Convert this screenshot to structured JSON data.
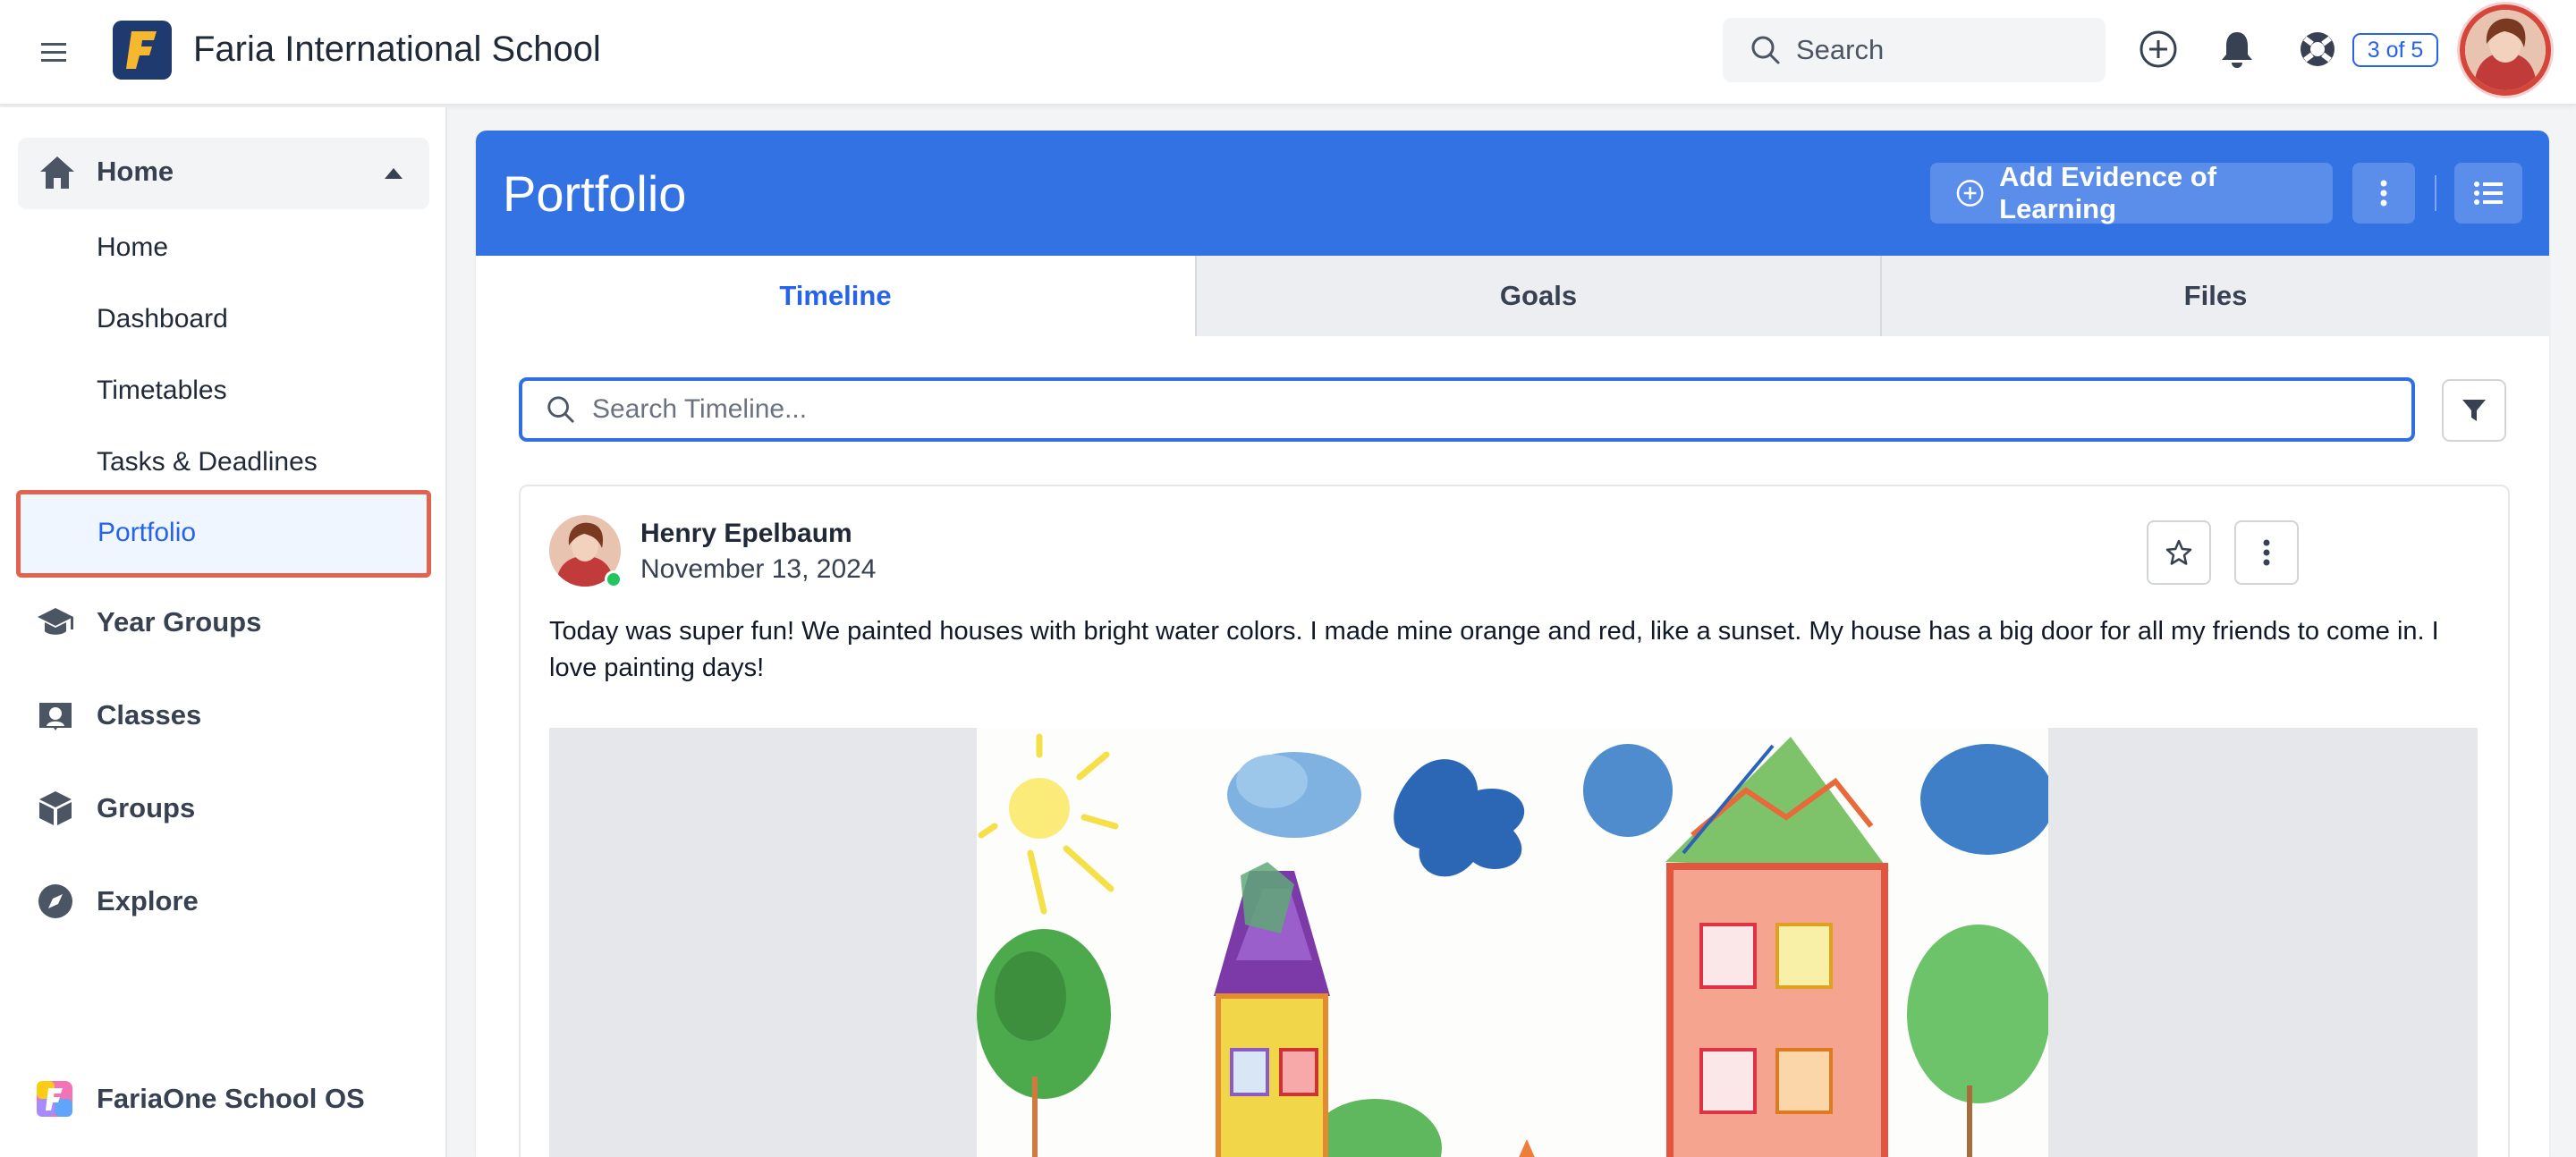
{
  "topbar": {
    "school_name": "Faria International School",
    "search_placeholder": "Search",
    "help_badge": "3 of 5",
    "icons": [
      "menu-icon",
      "faria-logo",
      "search-icon",
      "add-circle-icon",
      "bell-icon",
      "lifebuoy-icon"
    ]
  },
  "sidebar": {
    "section": {
      "label": "Home",
      "icon": "home-icon"
    },
    "sub_items": [
      "Home",
      "Dashboard",
      "Timetables",
      "Tasks & Deadlines",
      "Portfolio"
    ],
    "active_item": "Portfolio",
    "items": [
      {
        "label": "Year Groups",
        "icon": "graduation-cap-icon"
      },
      {
        "label": "Classes",
        "icon": "classes-icon"
      },
      {
        "label": "Groups",
        "icon": "cube-icon"
      },
      {
        "label": "Explore",
        "icon": "compass-icon"
      }
    ],
    "footer": {
      "label": "FariaOne School OS",
      "icon": "fariaone-logo"
    }
  },
  "page": {
    "title": "Portfolio",
    "add_button": "Add Evidence of Learning",
    "accent_color": "#3372e3",
    "tabs": [
      {
        "label": "Timeline",
        "active": true
      },
      {
        "label": "Goals",
        "active": false
      },
      {
        "label": "Files",
        "active": false
      }
    ],
    "search_placeholder": "Search Timeline..."
  },
  "post": {
    "author": "Henry Epelbaum",
    "date": "November 13, 2024",
    "text": "Today was super fun! We painted houses with bright water colors. I made mine orange and red, like a sunset. My house has a big door for all my friends to come in. I love painting days!",
    "author_status": "online"
  }
}
